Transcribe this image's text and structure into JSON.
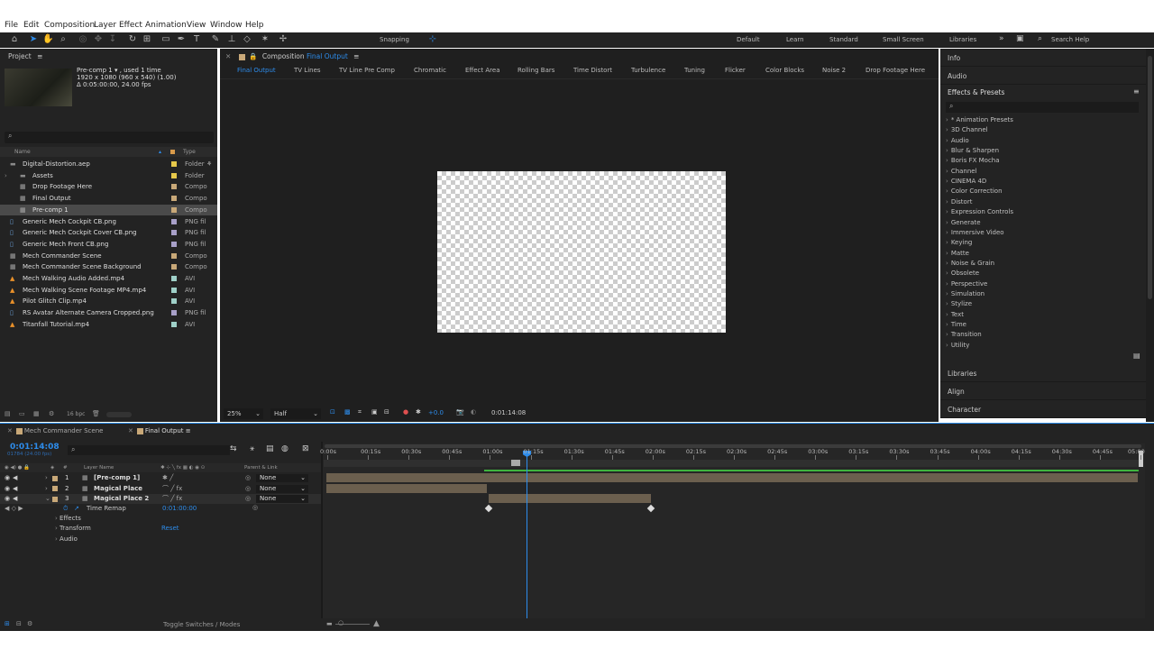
{
  "menu": [
    "File",
    "Edit",
    "Composition",
    "Layer",
    "Effect",
    "Animation",
    "View",
    "Window",
    "Help"
  ],
  "toolbar": {
    "snapping": "Snapping",
    "workspaces": [
      "Default",
      "Learn",
      "Standard",
      "Small Screen",
      "Libraries"
    ],
    "search_placeholder": "Search Help"
  },
  "project": {
    "title": "Project",
    "item_name": "Pre-comp 1",
    "item_used": ", used 1 time",
    "item_dims": "1920 x 1080  (960 x 540) (1.00)",
    "item_duration": "Δ 0:05:00:00, 24.00 fps",
    "col_name": "Name",
    "col_type": "Type",
    "bpc": "16 bpc",
    "items": [
      {
        "name": "Digital-Distortion.aep",
        "type": "Folder",
        "icon": "folder-icon",
        "color": "#e6c84a",
        "indent": 0
      },
      {
        "name": "Assets",
        "type": "Folder",
        "icon": "folder-icon",
        "color": "#e6c84a",
        "indent": 1
      },
      {
        "name": "Drop Footage Here",
        "type": "Compo",
        "icon": "composition-icon",
        "color": "#c8a878",
        "indent": 1
      },
      {
        "name": "Final Output",
        "type": "Compo",
        "icon": "composition-icon",
        "color": "#c8a878",
        "indent": 1
      },
      {
        "name": "Pre-comp 1",
        "type": "Compo",
        "icon": "composition-icon",
        "color": "#c8a878",
        "indent": 1
      },
      {
        "name": "Generic Mech Cockpit CB.png",
        "type": "PNG fil",
        "icon": "image-icon",
        "color": "#a8a0c8",
        "indent": 0
      },
      {
        "name": "Generic Mech Cockpit Cover CB.png",
        "type": "PNG fil",
        "icon": "image-icon",
        "color": "#a8a0c8",
        "indent": 0
      },
      {
        "name": "Generic Mech Front CB.png",
        "type": "PNG fil",
        "icon": "image-icon",
        "color": "#a8a0c8",
        "indent": 0
      },
      {
        "name": "Mech Commander Scene",
        "type": "Compo",
        "icon": "composition-icon",
        "color": "#c8a878",
        "indent": 0
      },
      {
        "name": "Mech Commander Scene Background",
        "type": "Compo",
        "icon": "composition-icon",
        "color": "#c8a878",
        "indent": 0
      },
      {
        "name": "Mech Walking Audio Added.mp4",
        "type": "AVI",
        "icon": "video-icon",
        "color": "#9fd0c8",
        "indent": 0
      },
      {
        "name": "Mech Walking Scene Footage MP4.mp4",
        "type": "AVI",
        "icon": "video-icon",
        "color": "#9fd0c8",
        "indent": 0
      },
      {
        "name": "Pilot Glitch Clip.mp4",
        "type": "AVI",
        "icon": "video-icon",
        "color": "#9fd0c8",
        "indent": 0
      },
      {
        "name": "RS Avatar Alternate Camera Cropped.png",
        "type": "PNG fil",
        "icon": "image-icon",
        "color": "#a8a0c8",
        "indent": 0
      },
      {
        "name": "Titanfall Tutorial.mp4",
        "type": "AVI",
        "icon": "video-icon",
        "color": "#9fd0c8",
        "indent": 0
      }
    ]
  },
  "composition": {
    "label": "Composition",
    "name": "Final Output",
    "tabs": [
      "Final Output",
      "TV Lines",
      "TV Line Pre Comp",
      "Chromatic",
      "Effect Area",
      "Rolling Bars",
      "Time Distort",
      "Turbulence",
      "Tuning",
      "Flicker",
      "Color Blocks",
      "Noise 2",
      "Drop Footage Here"
    ],
    "zoom": "25%",
    "resolution": "Half",
    "exposure": "+0.0",
    "timecode": "0:01:14:08"
  },
  "right": {
    "info": "Info",
    "audio": "Audio",
    "effects_title": "Effects & Presets",
    "effects": [
      "* Animation Presets",
      "3D Channel",
      "Audio",
      "Blur & Sharpen",
      "Boris FX Mocha",
      "Channel",
      "CINEMA 4D",
      "Color Correction",
      "Distort",
      "Expression Controls",
      "Generate",
      "Immersive Video",
      "Keying",
      "Matte",
      "Noise & Grain",
      "Obsolete",
      "Perspective",
      "Simulation",
      "Stylize",
      "Text",
      "Time",
      "Transition",
      "Utility"
    ],
    "libraries": "Libraries",
    "align": "Align",
    "character": "Character"
  },
  "timeline": {
    "tab1": "Mech Commander Scene",
    "tab2": "Final Output",
    "timecode": "0:01:14:08",
    "frames": "01784 (24.00 fps)",
    "col_layer_name": "Layer Name",
    "col_parent": "Parent & Link",
    "ticks": [
      "0:00s",
      "00:15s",
      "00:30s",
      "00:45s",
      "01:00s",
      "01:15s",
      "01:30s",
      "01:45s",
      "02:00s",
      "02:15s",
      "02:30s",
      "02:45s",
      "03:00s",
      "03:15s",
      "03:30s",
      "03:45s",
      "04:00s",
      "04:15s",
      "04:30s",
      "04:45s",
      "05:00"
    ],
    "layers": [
      {
        "num": "1",
        "name": "[Pre-comp 1]",
        "parent": "None"
      },
      {
        "num": "2",
        "name": "Magical Place",
        "parent": "None"
      },
      {
        "num": "3",
        "name": "Magical Place 2",
        "parent": "None"
      }
    ],
    "time_remap": "Time Remap",
    "time_remap_value": "0:01:00:00",
    "effects": "Effects",
    "transform": "Transform",
    "reset": "Reset",
    "audio": "Audio",
    "toggle": "Toggle Switches / Modes"
  },
  "colors": {
    "accent": "#2d8ceb",
    "panel": "#232323",
    "layer_bar": "#6b5f4e",
    "work_area": "#3fb43f"
  }
}
